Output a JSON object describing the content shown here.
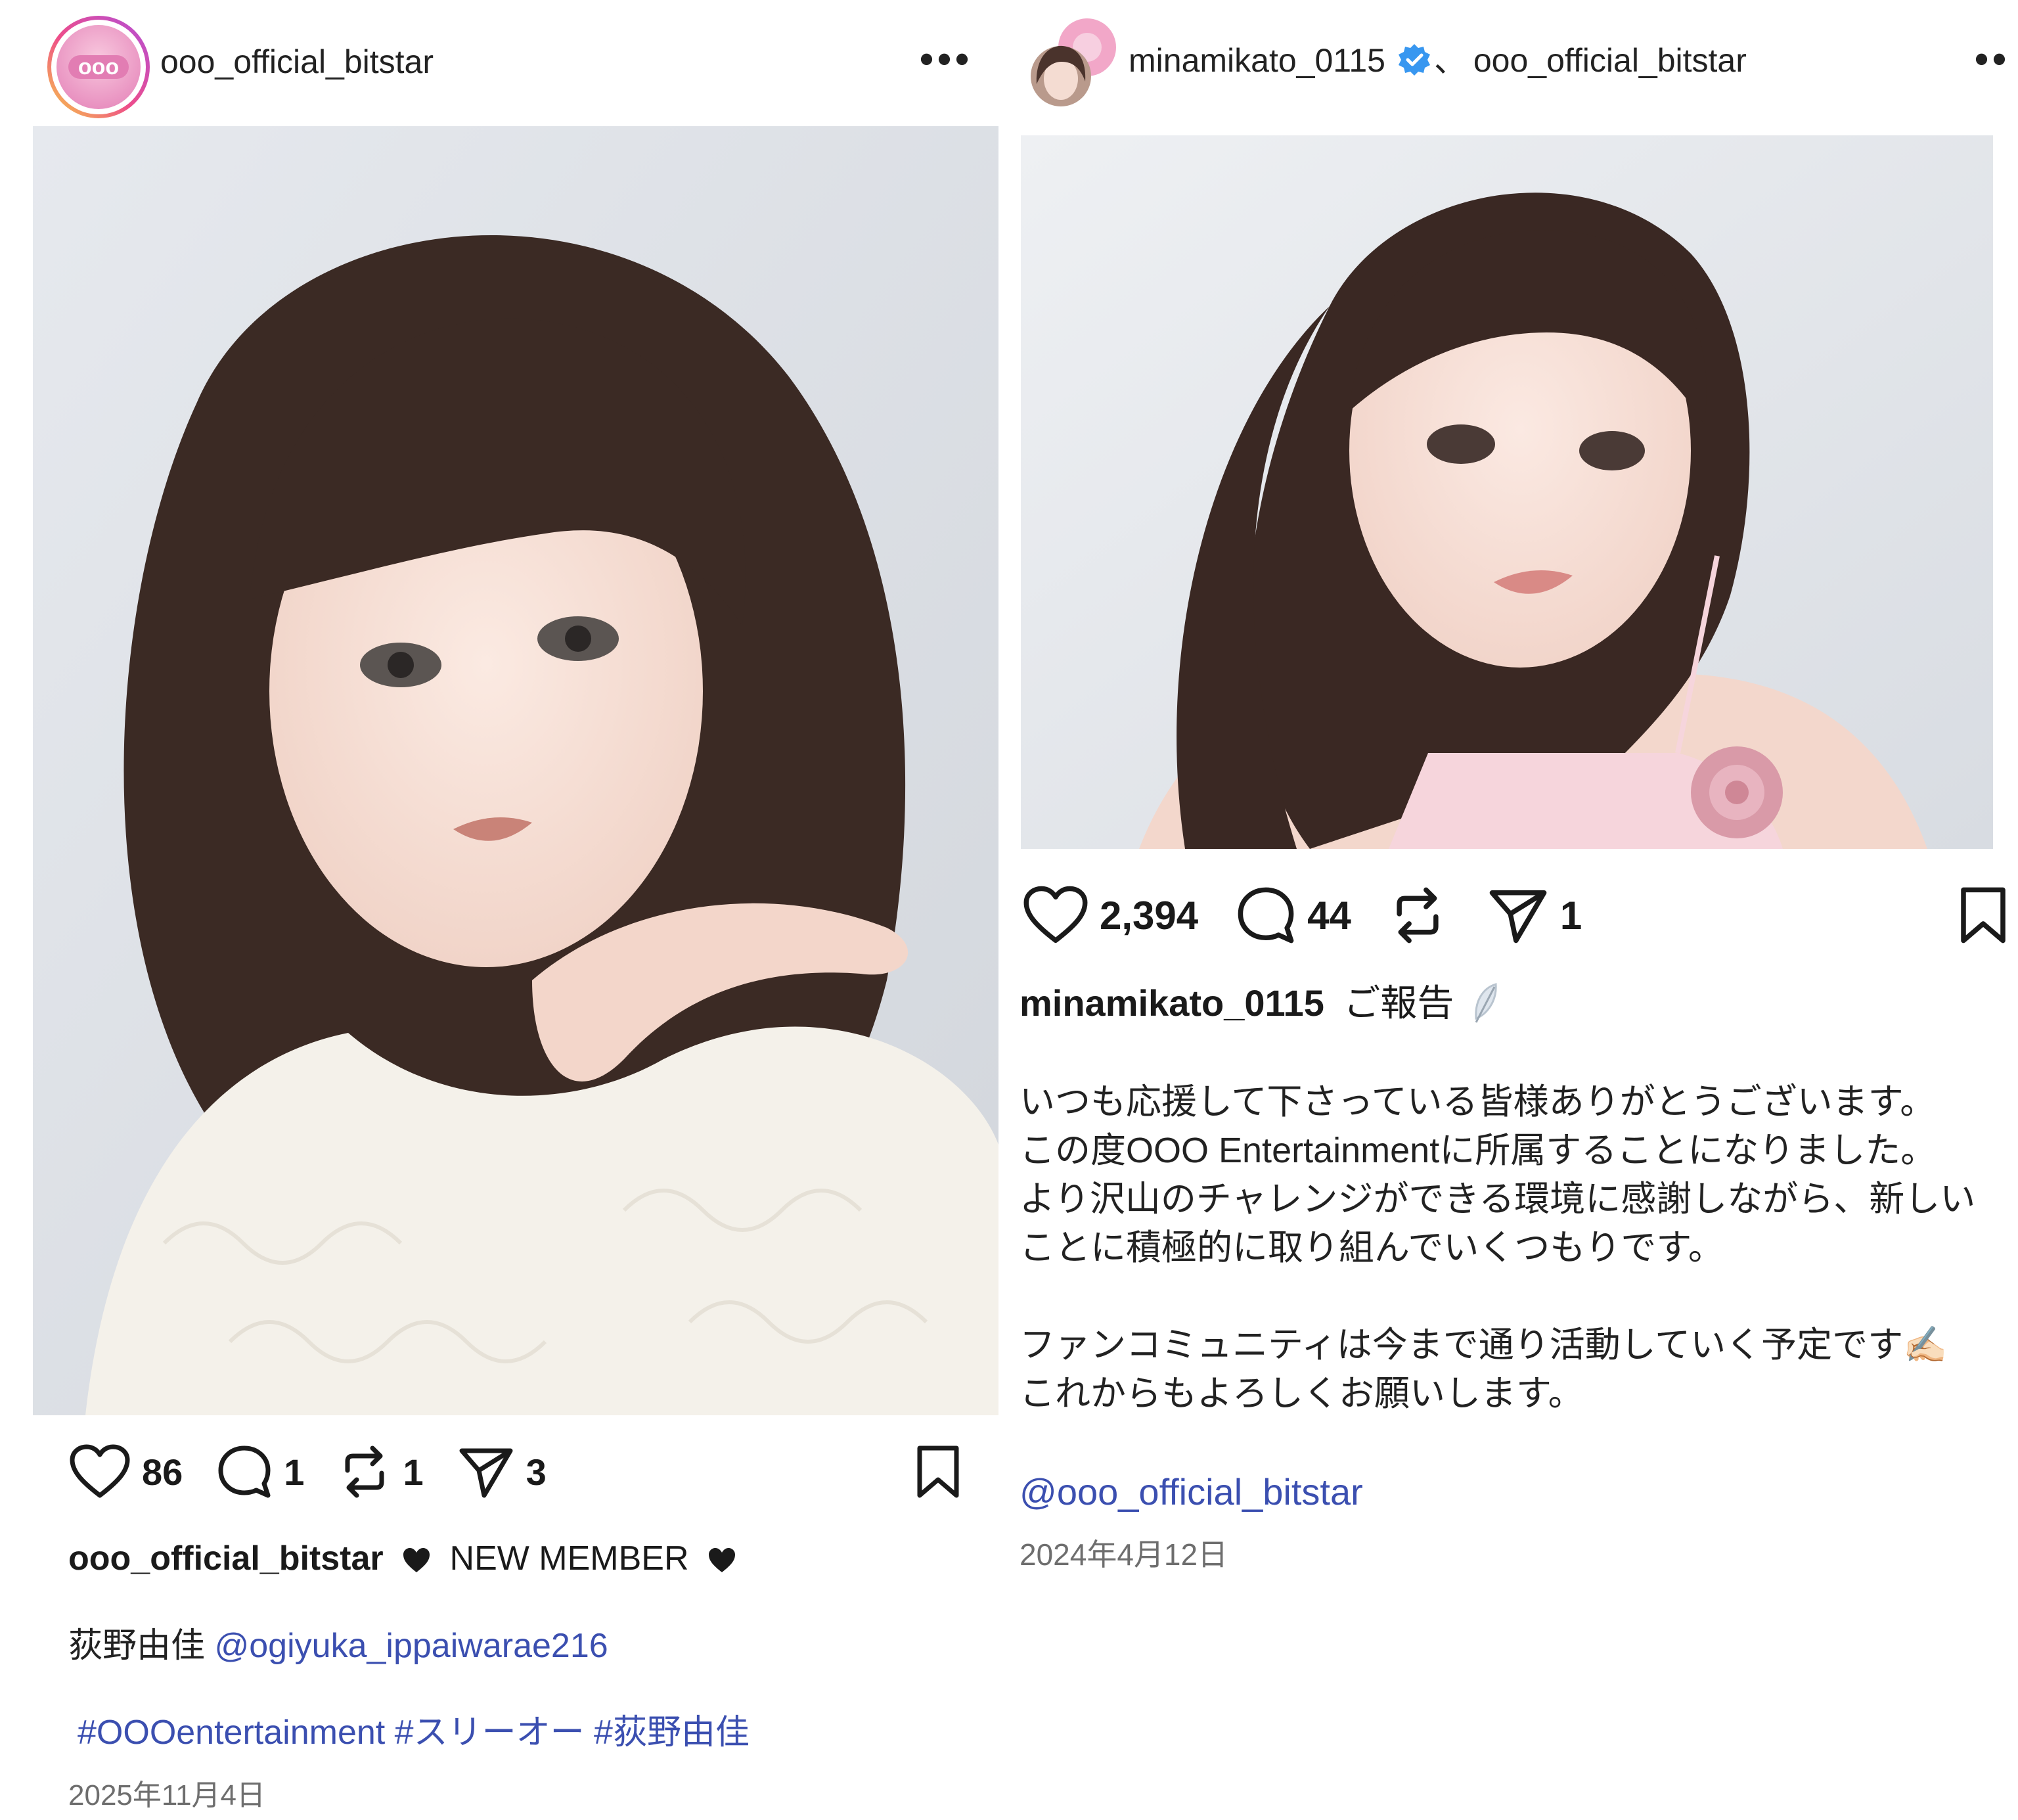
{
  "left_post": {
    "header_username": "ooo_official_bitstar",
    "avatar_text": "ooo",
    "more_label": "•••",
    "stats": {
      "likes": "86",
      "comments": "1",
      "reposts": "1",
      "shares": "3"
    },
    "caption_username": "ooo_official_bitstar",
    "caption_headline": "NEW MEMBER",
    "name_line": "荻野由佳",
    "name_mention": "@ogiyuka_ippaiwarae216",
    "hashtags": "#OOOentertainment #スリーオー #荻野由佳",
    "date": "2025年11月4日"
  },
  "right_post": {
    "header_username": "minamikato_0115",
    "header_separator": "、",
    "header_collab": "ooo_official_bitstar",
    "more_label": "••",
    "stats": {
      "likes": "2,394",
      "comments": "44",
      "shares": "1"
    },
    "caption_username": "minamikato_0115",
    "caption_title": "ご報告",
    "caption_lines": [
      "いつも応援して下さっている皆様ありがとうございます。",
      "この度OOO Entertainmentに所属することになりました。",
      "より沢山のチャレンジができる環境に感謝しながら、新しい",
      "ことに積極的に取り組んでいくつもりです。",
      "",
      "ファンコミュニティは今まで通り活動していく予定です✍🏻",
      "これからもよろしくお願いします。"
    ],
    "mention": "@ooo_official_bitstar",
    "date": "2024年4月12日"
  },
  "colors": {
    "link": "#3b4fb0",
    "date_gray": "#6e6e6e",
    "verified_blue": "#3897f0",
    "avatar_pink": "#f2a7c8"
  }
}
